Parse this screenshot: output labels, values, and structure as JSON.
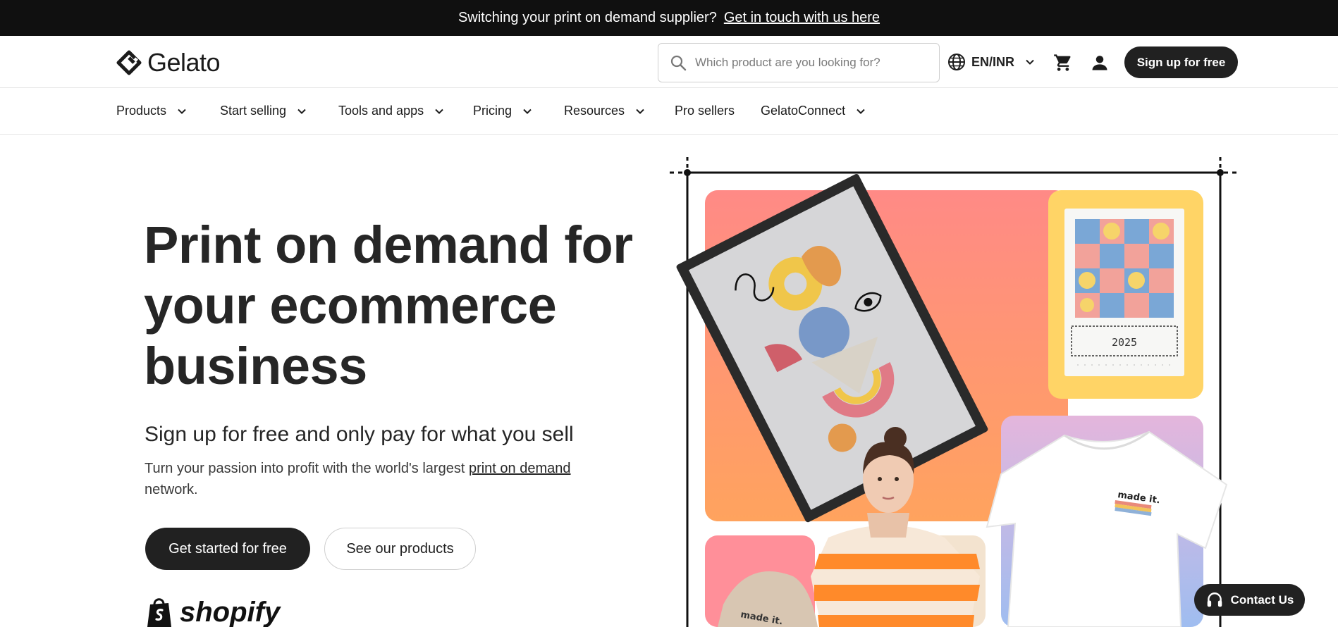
{
  "banner": {
    "text": "Switching your print on demand supplier?",
    "link": "Get in touch with us here"
  },
  "header": {
    "logo": "Gelato",
    "search_placeholder": "Which product are you looking for?",
    "language": "EN/INR",
    "signup": "Sign up for free"
  },
  "nav": {
    "items": [
      {
        "label": "Products",
        "dropdown": true
      },
      {
        "label": "Start selling",
        "dropdown": true
      },
      {
        "label": "Tools and apps",
        "dropdown": true
      },
      {
        "label": "Pricing",
        "dropdown": true
      },
      {
        "label": "Resources",
        "dropdown": true
      },
      {
        "label": "Pro sellers",
        "dropdown": false
      },
      {
        "label": "GelatoConnect",
        "dropdown": true
      }
    ]
  },
  "hero": {
    "title": "Print on demand for your ecommerce business",
    "subtitle": "Sign up for free and only pay for what you sell",
    "desc_before": "Turn your passion into profit with the world's largest ",
    "desc_link": "print on demand",
    "desc_after": " network.",
    "primary_cta": "Get started for free",
    "secondary_cta": "See our products",
    "partner": "shopify"
  },
  "visual": {
    "calendar_year": "2025",
    "tshirt_label": "made it.",
    "beanie_label": "made it."
  },
  "contact": {
    "label": "Contact Us"
  },
  "colors": {
    "dark": "#212121",
    "banner": "#101010",
    "coral": "#ff8f7a",
    "yellow": "#ffd466",
    "lavender": "#d9b8e6",
    "orange": "#ff8a2a"
  }
}
